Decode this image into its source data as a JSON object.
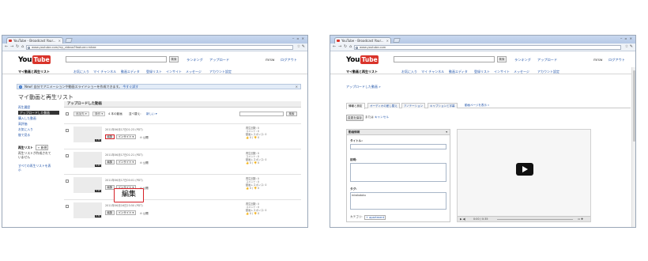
{
  "left": {
    "browser": {
      "tab_title": "YouTube - Broadcast Your...",
      "tab_close": "×",
      "window_controls": "‒ ▫ ×",
      "url": "www.youtube.com/my_videos?feature=mhee",
      "tools": "☆ ✎"
    },
    "header": {
      "logo_you": "You",
      "logo_tube": "Tube",
      "search_button": "検索",
      "links": [
        "ランキング",
        "アップロード"
      ],
      "user": "mrsw",
      "logout": "ログアウト"
    },
    "subnav": [
      "マイ動画と再生リスト",
      "お気に入り",
      "マイ チャンネル",
      "動画エディタ",
      "登録リスト",
      "インサイト",
      "メッセージ",
      "アカウント設定"
    ],
    "notice": {
      "icon": "i",
      "text": "New! 自分でアニメーションや動画スライドショーを作成できます。",
      "link": "今すぐ試す",
      "close": "×"
    },
    "page_title": "マイ動画と再生リスト",
    "sidebar": {
      "items": [
        "再生履歴",
        "アップロードした動画",
        "購入した動画",
        "高評価",
        "お気に入り",
        "後で見る"
      ],
      "playlists_heading": "再生リスト",
      "new_button": "+ 新規",
      "empty_text": "再生リストが作成されていません",
      "all_link": "すべての再生リストを表示"
    },
    "main_title": "アップロードした動画",
    "toolbar": {
      "btn_add": "追加先 ▾",
      "btn_ops": "操作 ▾",
      "count": "4 本の動画",
      "sort_label": "並べ替え:",
      "sort_value": "新しい ▾",
      "search_button": "検索"
    },
    "videos": [
      {
        "date": "2011年06月17日01:23 (PDT)",
        "duration": "0:35",
        "edit": "編集",
        "insight": "インサイト ▾",
        "privacy": "⊙ 公開",
        "stats": [
          "再生回数: 0",
          "コメント: 0",
          "動画レスポンス: 0",
          "👍 0 / 👎 0"
        ]
      },
      {
        "date": "2011年06月17日01:21 (PDT)",
        "duration": "0:45",
        "edit": "編集",
        "insight": "インサイト ▾",
        "privacy": "⊙ 公開",
        "stats": [
          "再生回数: 0",
          "コメント: 0",
          "動画レスポンス: 0",
          "👍 0 / 👎 0"
        ]
      },
      {
        "date": "2011年06月17日00:01 (PDT)",
        "duration": "0:20",
        "edit": "編集",
        "insight": "インサイト ▾",
        "privacy": "⊙ 公開",
        "stats": [
          "再生回数: 0",
          "コメント: 0",
          "動画レスポンス: 0",
          "👍 0 / 👎 0"
        ]
      },
      {
        "date": "2011年06月16日23:50 (PDT)",
        "duration": "0:30",
        "edit": "編集",
        "insight": "インサイト ▾",
        "privacy": "⊙ 公開",
        "stats": [
          "再生回数: 0",
          "コメント: 0",
          "動画レスポンス: 0",
          "👍 0 / 👎 0"
        ]
      }
    ],
    "callout": "編集"
  },
  "right": {
    "browser": {
      "tab_title": "YouTube - Broadcast Your...",
      "tab_close": "×",
      "window_controls": "‒ ▫ ×",
      "url": "www.youtube.com",
      "tools": "☆ ✎"
    },
    "header": {
      "logo_you": "You",
      "logo_tube": "Tube",
      "search_button": "検索",
      "links": [
        "ランキング",
        "アップロード"
      ],
      "user": "mrsw",
      "logout": "ログアウト"
    },
    "subnav": [
      "マイ動画と再生リスト",
      "お気に入り",
      "マイ チャンネル",
      "動画エディタ",
      "登録リスト",
      "インサイト",
      "メッセージ",
      "アカウント設定"
    ],
    "breadcrumb": "アップロードした動画 »",
    "edit_tabs": [
      "情報と設定",
      "オーディオの差し替え",
      "アノテーション",
      "キャプションと字幕"
    ],
    "edit_tab_link": "動画ページを表示 »",
    "save_button": "変更を保存",
    "or_text": "または",
    "cancel_link": "キャンセル",
    "form": {
      "heading": "動画情報",
      "title_label": "タイトル:",
      "desc_label": "説明:",
      "tags_label": "タグ:",
      "tags_value": "mirakotoku",
      "category_label": "カテゴリ:",
      "category_value": "+ apartment"
    },
    "player": {
      "controls_play": "▶ ◀|",
      "time": "0:00 / 0:35",
      "right_controls": "▭ ✚"
    }
  }
}
